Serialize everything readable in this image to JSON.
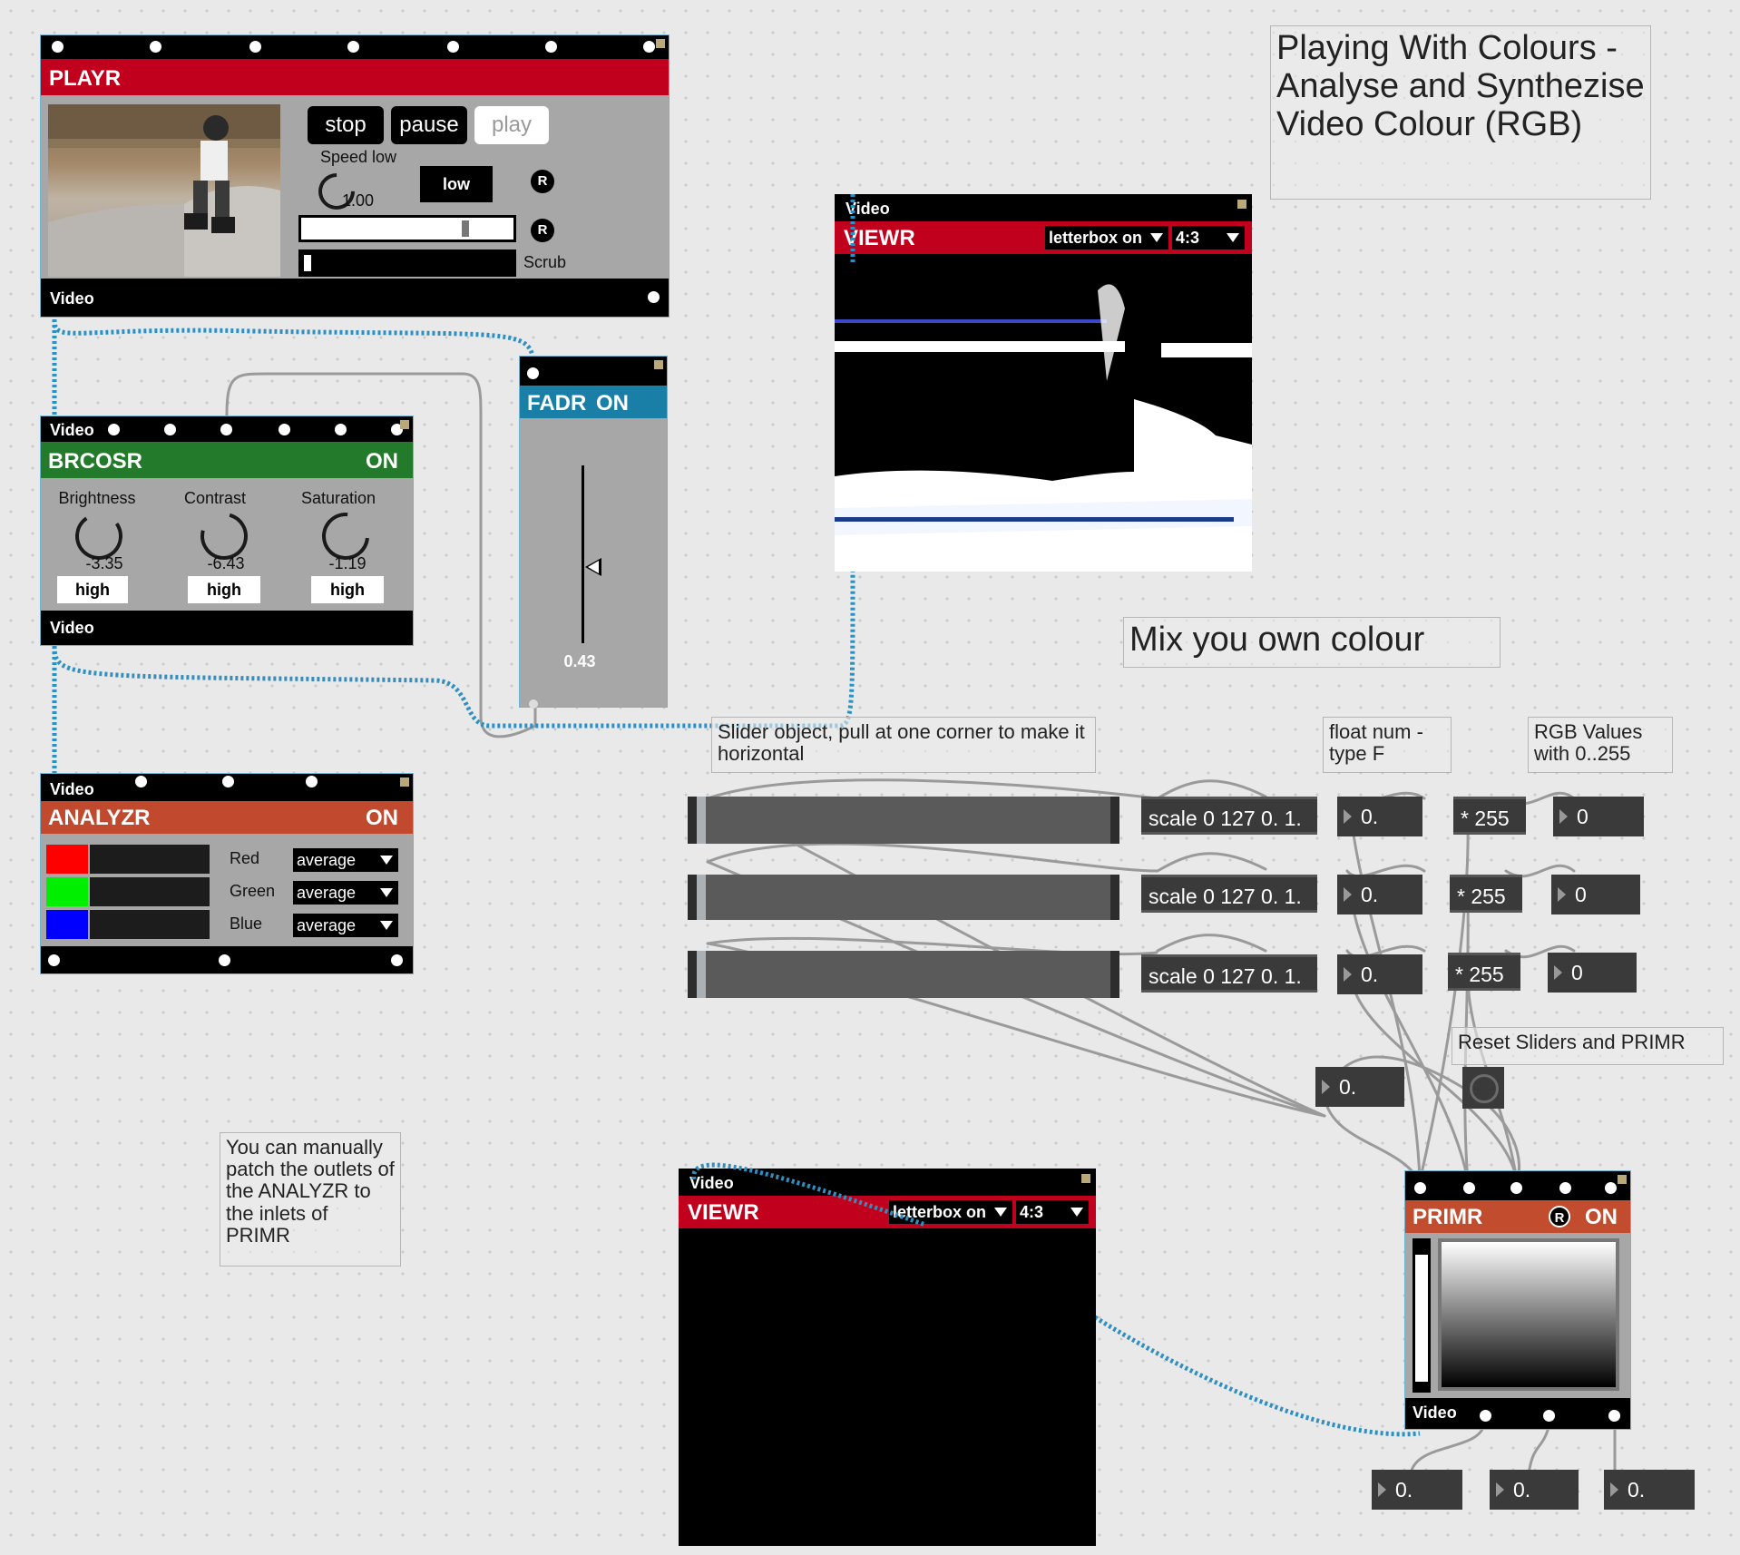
{
  "playr": {
    "title": "PLAYR",
    "stop_label": "stop",
    "pause_label": "pause",
    "play_label": "play",
    "speed_label": "Speed low",
    "speed_value": "1.00",
    "low_label": "low",
    "scrub_label": "Scrub",
    "reset_label": "R",
    "footer": "Video"
  },
  "viewr_top": {
    "header": "Video",
    "title": "VIEWR",
    "mode": "letterbox on",
    "aspect": "4:3"
  },
  "title_comment": "Playing With Colours - Analyse and Synthezise Video Colour (RGB)",
  "brcosr": {
    "header": "Video",
    "title": "BRCOSR",
    "status": "ON",
    "knobs": [
      {
        "label": "Brightness",
        "value": "-3.35",
        "button": "high"
      },
      {
        "label": "Contrast",
        "value": "-6.43",
        "button": "high"
      },
      {
        "label": "Saturation",
        "value": "-1.19",
        "button": "high"
      }
    ],
    "footer": "Video"
  },
  "fadr": {
    "title": "FADR",
    "status": "ON",
    "value": "0.43",
    "level": 0.43
  },
  "analyzr": {
    "header": "Video",
    "title": "ANALYZR",
    "status": "ON",
    "channels": [
      {
        "label": "Red",
        "mode": "average",
        "color": "#ff0000"
      },
      {
        "label": "Green",
        "mode": "average",
        "color": "#00ee00"
      },
      {
        "label": "Blue",
        "mode": "average",
        "color": "#0000ff"
      }
    ]
  },
  "comments": {
    "mix": "Mix you own colour",
    "slider_note": "Slider object, pull at one corner to make it horizontal",
    "float_note": "float num - type F",
    "rgb_note": "RGB Values with 0..255",
    "reset_note": "Reset Sliders and PRIMR",
    "patch_note": "You can manually patch the outlets of the ANALYZR to the inlets of PRIMR"
  },
  "rows": [
    {
      "scale": "scale 0 127 0. 1.",
      "float": "0.",
      "mult": "* 255",
      "int": "0"
    },
    {
      "scale": "scale 0 127 0. 1.",
      "float": "0.",
      "mult": "* 255",
      "int": "0"
    },
    {
      "scale": "scale 0 127 0. 1.",
      "float": "0.",
      "mult": "* 255",
      "int": "0"
    }
  ],
  "extra_float": "0.",
  "viewr_bottom": {
    "header": "Video",
    "title": "VIEWR",
    "mode": "letterbox on",
    "aspect": "4:3"
  },
  "primr": {
    "title": "PRIMR",
    "reset_label": "R",
    "status": "ON",
    "footer": "Video"
  },
  "out_floats": [
    "0.",
    "0.",
    "0."
  ],
  "colors": {
    "playr_red": "#c0001d",
    "brcosr_green": "#237a2b",
    "fadr_blue": "#1a7fa6",
    "analyzr_orange": "#c14a2e",
    "primr_orange": "#c24c2e",
    "wire_blue": "#2f8fc0"
  }
}
